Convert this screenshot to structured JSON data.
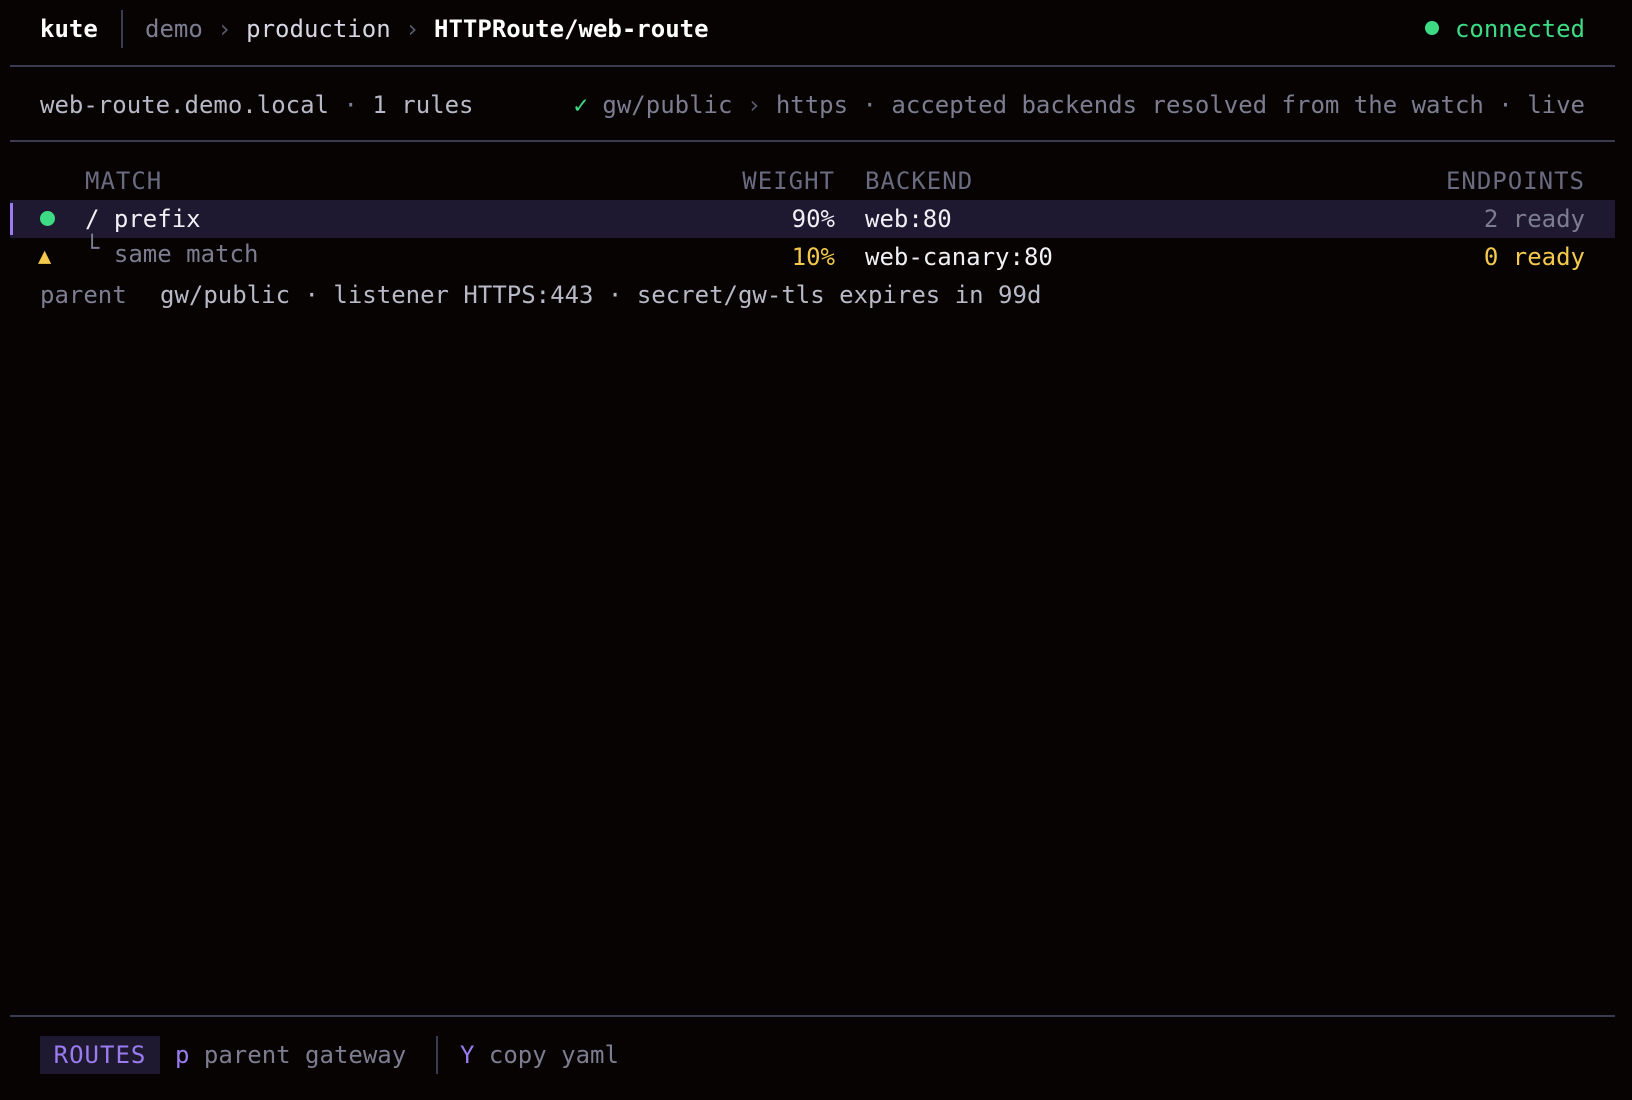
{
  "app": {
    "name": "kute"
  },
  "breadcrumb": {
    "context": "demo",
    "namespace": "production",
    "resource": "HTTPRoute/web-route",
    "separator": "›"
  },
  "connection": {
    "status": "connected",
    "color": "#3ddc84"
  },
  "summary": {
    "host": "web-route.demo.local",
    "rules": "1 rules",
    "dot_sep": "·",
    "check": "✓",
    "gateway": "gw/public",
    "listener": "https",
    "state": "accepted",
    "note": "backends resolved from the watch",
    "live": "live"
  },
  "table": {
    "headers": {
      "match": "MATCH",
      "weight": "WEIGHT",
      "backend": "BACKEND",
      "endpoints": "ENDPOINTS"
    },
    "rows": [
      {
        "status_icon": "green-dot-icon",
        "match": "/ prefix",
        "weight": "90%",
        "backend": "web:80",
        "endpoints": "2 ready"
      },
      {
        "status_icon": "warning-triangle-icon",
        "status_glyph": "▲",
        "tree": "└",
        "match": "same match",
        "weight": "10%",
        "backend": "web-canary:80",
        "endpoints": "0 ready"
      }
    ],
    "parent": {
      "label": "parent",
      "value": "gw/public · listener HTTPS:443 · secret/gw-tls expires in 99d"
    }
  },
  "footer": {
    "mode": "ROUTES",
    "shortcuts": [
      {
        "key": "p",
        "label": "parent gateway"
      },
      {
        "key": "Y",
        "label": "copy yaml"
      }
    ]
  },
  "colors": {
    "background": "#070302",
    "accent": "#9a7cf0",
    "ok": "#3ddc84",
    "warn": "#f2c94c",
    "selection": "#1e1930"
  }
}
